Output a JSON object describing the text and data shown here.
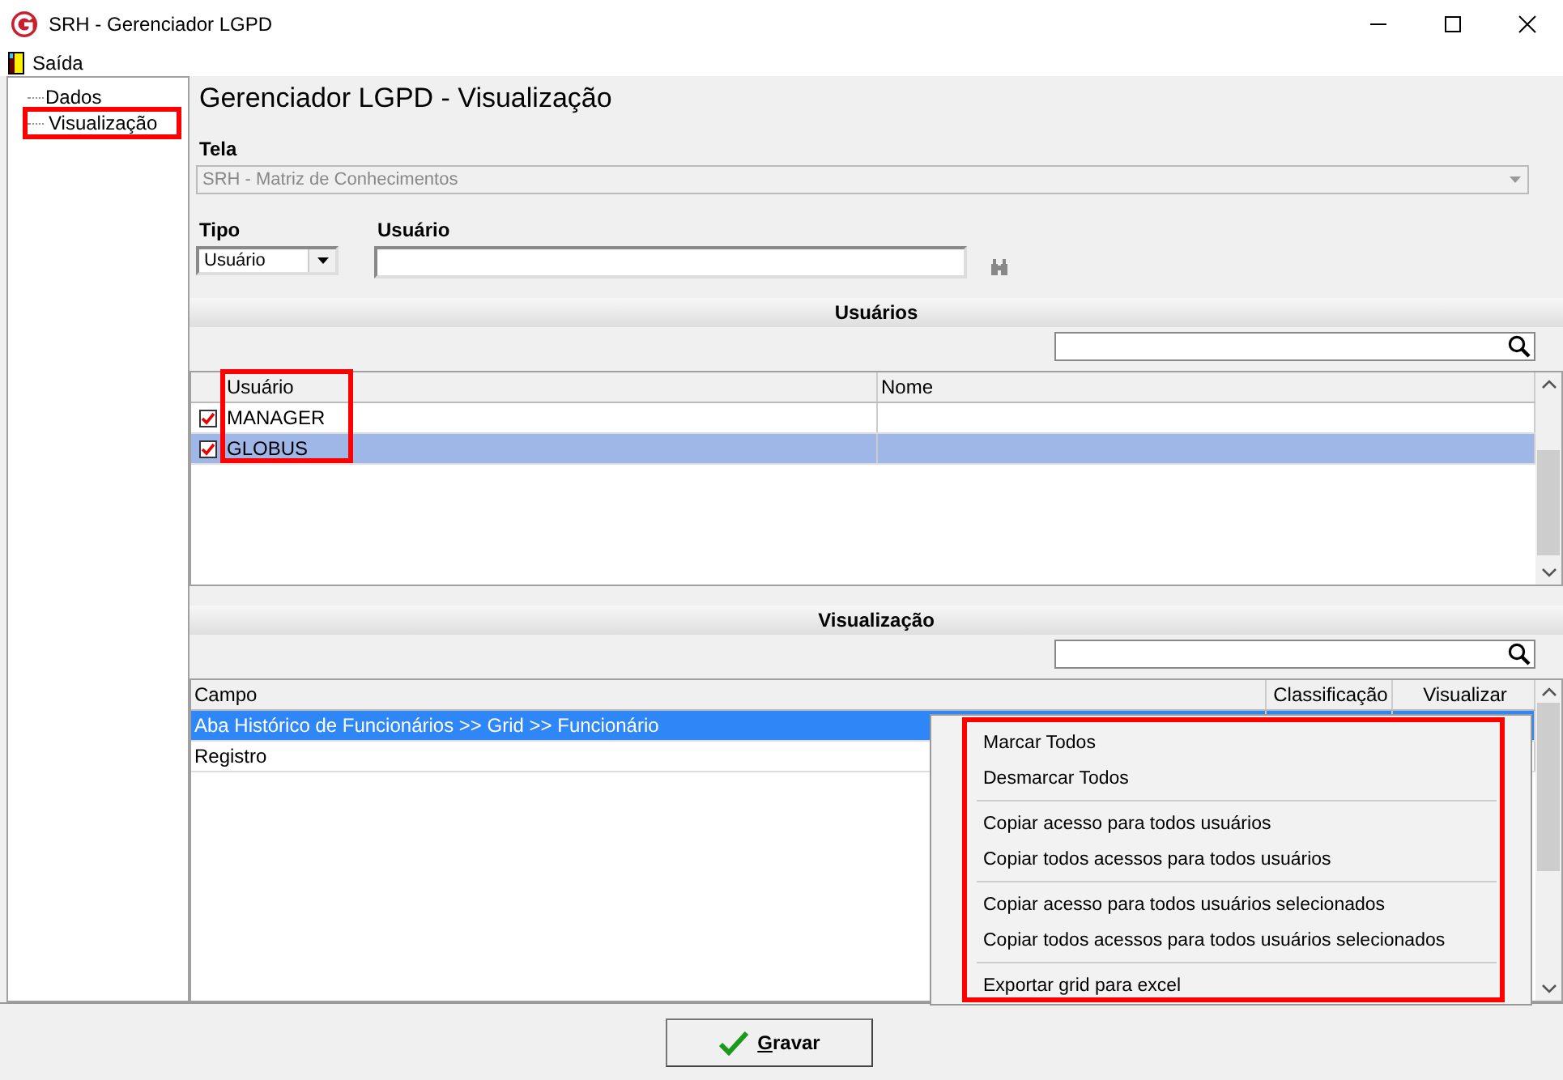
{
  "window": {
    "title": "SRH - Gerenciador LGPD"
  },
  "menu_bar": {
    "items": [
      {
        "label": "Saída"
      }
    ]
  },
  "sidebar": {
    "items": [
      {
        "label": "Dados",
        "selected": false
      },
      {
        "label": "Visualização",
        "selected": true
      }
    ]
  },
  "heading": "Gerenciador LGPD - Visualização",
  "tela": {
    "label": "Tela",
    "value": "SRH - Matriz de Conhecimentos",
    "disabled": true
  },
  "tipo": {
    "label": "Tipo",
    "value": "Usuário"
  },
  "usuario": {
    "label": "Usuário"
  },
  "usuarios_panel": {
    "title": "Usuários",
    "columns": [
      "Usuário",
      "Nome"
    ],
    "rows": [
      {
        "usuario": "MANAGER",
        "checked": true,
        "selected": false
      },
      {
        "usuario": "GLOBUS",
        "checked": true,
        "selected": true
      }
    ]
  },
  "visualizacao_panel": {
    "title": "Visualização",
    "columns": [
      "Campo",
      "Classificação",
      "Visualizar"
    ],
    "rows": [
      {
        "campo": "Aba Histórico de Funcionários >> Grid >> Funcionário",
        "selected": true
      },
      {
        "campo": "Registro",
        "selected": false
      }
    ]
  },
  "context_menu": {
    "groups": [
      [
        "Marcar Todos",
        "Desmarcar Todos"
      ],
      [
        "Copiar acesso para todos usuários",
        "Copiar todos acessos para todos usuários"
      ],
      [
        "Copiar acesso para todos usuários selecionados",
        "Copiar todos acessos para todos usuários selecionados"
      ],
      [
        "Exportar grid para excel"
      ]
    ]
  },
  "buttons": [
    {
      "label": "Gravar"
    }
  ]
}
